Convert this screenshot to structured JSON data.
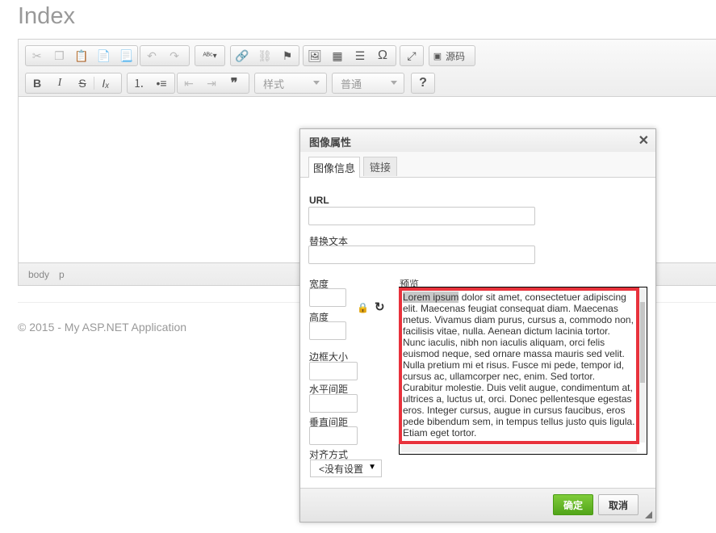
{
  "page": {
    "title": "Index"
  },
  "toolbar": {
    "icons_row1": [
      "cut-icon",
      "copy-icon",
      "paste-icon",
      "paste-text-icon",
      "paste-word-icon",
      "undo-icon",
      "redo-icon",
      "spellcheck-icon",
      "link-icon",
      "unlink-icon",
      "anchor-icon",
      "image-icon",
      "table-icon",
      "horizontal-line-icon",
      "special-char-icon",
      "maximize-icon",
      "source-icon"
    ],
    "source_label": "源码",
    "icons_row2": [
      "bold-icon",
      "italic-icon",
      "strike-icon",
      "remove-format-icon",
      "numbered-list-icon",
      "bulleted-list-icon",
      "outdent-icon",
      "indent-icon",
      "blockquote-icon",
      "help-icon"
    ],
    "style_combo": "样式",
    "format_combo": "普通",
    "help_label": "?"
  },
  "path_bar": {
    "items": [
      "body",
      "p"
    ]
  },
  "footer": {
    "text": "© 2015 - My ASP.NET Application"
  },
  "dialog": {
    "title": "图像属性",
    "close": "✕",
    "tabs": [
      {
        "label": "图像信息",
        "active": true
      },
      {
        "label": "链接",
        "active": false
      }
    ],
    "url_label": "URL",
    "url_value": "",
    "alt_label": "替换文本",
    "alt_value": "",
    "width_label": "宽度",
    "height_label": "高度",
    "border_label": "边框大小",
    "hspace_label": "水平间距",
    "vspace_label": "垂直间距",
    "align_label": "对齐方式",
    "align_value": "<没有设置",
    "preview_label": "预览",
    "preview_highlight": "Lorem ipsum",
    "preview_text": " dolor sit amet, consectetuer adipiscing elit. Maecenas feugiat consequat diam. Maecenas metus. Vivamus diam purus, cursus a, commodo non, facilisis vitae, nulla. Aenean dictum lacinia tortor. Nunc iaculis, nibh non iaculis aliquam, orci felis euismod neque, sed ornare massa mauris sed velit. Nulla pretium mi et risus. Fusce mi pede, tempor id, cursus ac, ullamcorper nec, enim. Sed tortor. Curabitur molestie. Duis velit augue, condimentum at, ultrices a, luctus ut, orci. Donec pellentesque egestas eros. Integer cursus, augue in cursus faucibus, eros pede bibendum sem, in tempus tellus justo quis ligula. Etiam eget tortor.",
    "ok_label": "确定",
    "cancel_label": "取消"
  },
  "colors": {
    "highlight_border": "#e8323c",
    "ok_button": "#5cb025"
  }
}
